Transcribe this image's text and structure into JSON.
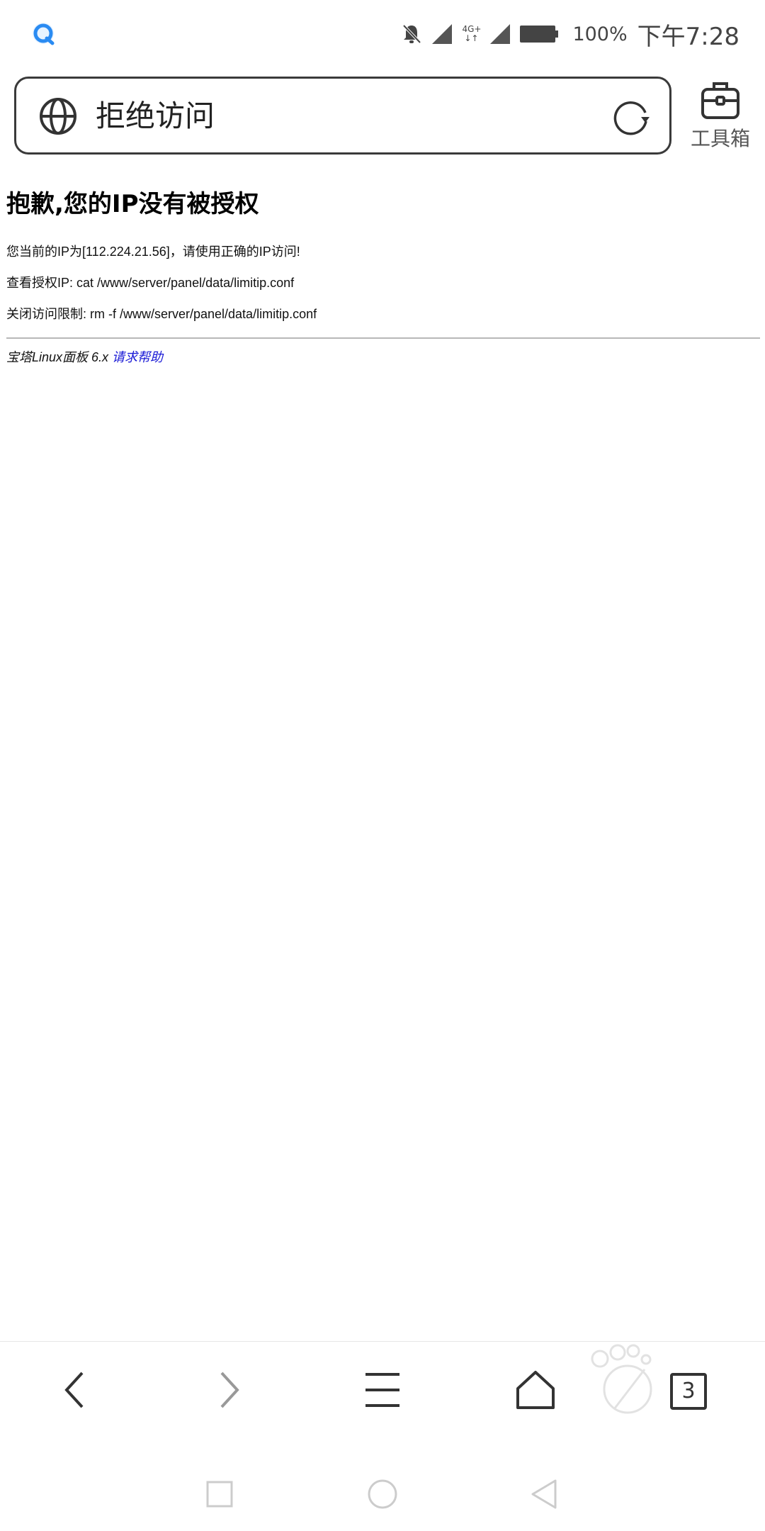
{
  "status_bar": {
    "network_type": "4G+",
    "battery_percent": "100%",
    "time": "下午7:28"
  },
  "address_bar": {
    "title": "拒绝访问"
  },
  "toolbox": {
    "label": "工具箱"
  },
  "page": {
    "heading": "抱歉,您的IP没有被授权",
    "lines": [
      "您当前的IP为[112.224.21.56]，请使用正确的IP访问!",
      "查看授权IP: cat /www/server/panel/data/limitip.conf",
      "关闭访问限制: rm -f /www/server/panel/data/limitip.conf"
    ],
    "footer_text": "宝塔Linux面板 6.x ",
    "footer_link": "请求帮助"
  },
  "bottom_nav": {
    "tabs_count": "3"
  },
  "colors": {
    "link": "#1a1ad6",
    "icon_dark": "#333333",
    "icon_light": "#cccccc"
  }
}
